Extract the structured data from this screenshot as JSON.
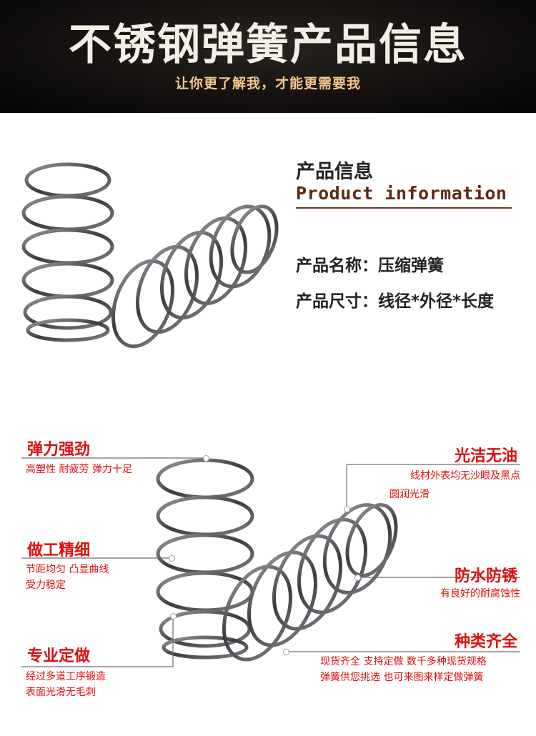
{
  "banner": {
    "title": "不锈钢弹簧产品信息",
    "subtitle": "让你更了解我，才能更需要我"
  },
  "product_info": {
    "title": "产品信息",
    "title_en": "Product information",
    "name_row": "产品名称：压缩弹簧",
    "size_row": "产品尺寸：线径*外径*长度"
  },
  "features": {
    "elasticity": {
      "title": "弹力强劲",
      "desc": "高塑性 耐疲劳 弹力十足"
    },
    "craft": {
      "title": "做工精细",
      "desc_1": "节距均匀 凸显曲线",
      "desc_2": "受力稳定"
    },
    "custom": {
      "title": "专业定做",
      "desc_1": "经过多道工序锻造",
      "desc_2": "表面光滑无毛刺"
    },
    "clean": {
      "title": "光洁无油",
      "desc_1": "线材外表均无沙眼及黑点",
      "desc_2": "圆润光滑"
    },
    "rustproof": {
      "title": "防水防锈",
      "desc": "有良好的耐腐蚀性"
    },
    "variety": {
      "title": "种类齐全",
      "desc_1": "现货齐全 支持定做 数千多种现货规格",
      "desc_2": "弹簧供您挑选 也可来图来样定做弹簧"
    }
  },
  "colors": {
    "accent_red": "#e10e0e",
    "banner_bg": "#141110",
    "subtitle_gold": "#f4c98a",
    "underline_brown": "#6b3a1d"
  },
  "images": {
    "top_springs": "stainless-steel-compression-springs-photo",
    "bottom_springs": "stainless-steel-compression-springs-callout-photo"
  }
}
